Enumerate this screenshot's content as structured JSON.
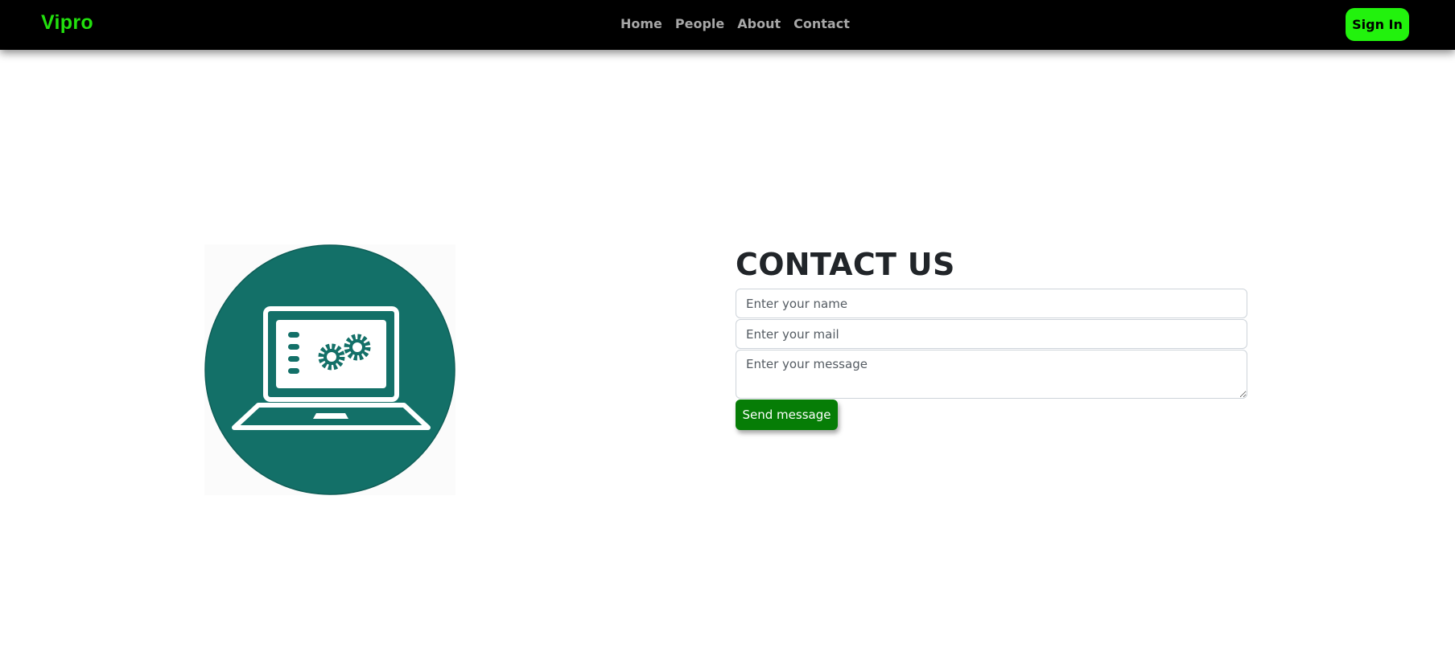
{
  "navbar": {
    "brand": "Vipro",
    "links": [
      "Home",
      "People",
      "About",
      "Contact"
    ],
    "signin_label": "Sign In"
  },
  "hero": {
    "icon": "laptop-settings-icon",
    "circle_color": "#137068"
  },
  "contact": {
    "title": "CONTACT US",
    "name_placeholder": "Enter your name",
    "mail_placeholder": "Enter your mail",
    "message_placeholder": "Enter your message",
    "send_label": "Send message"
  },
  "colors": {
    "brand": "#22e00d",
    "signin_bg": "#22f20d",
    "send_bg": "#067d06",
    "navbar_bg": "#000000"
  }
}
